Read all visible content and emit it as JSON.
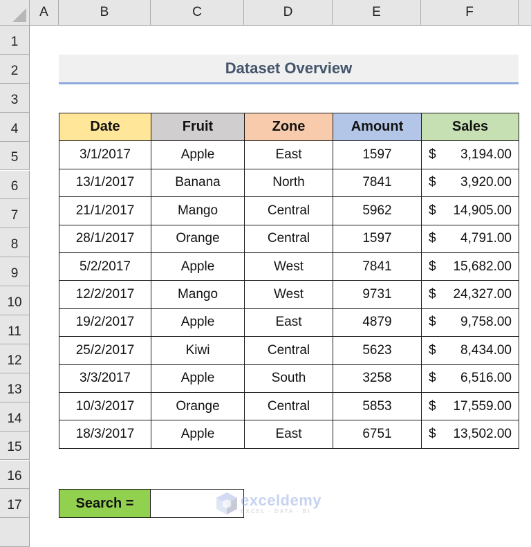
{
  "spreadsheet": {
    "column_headers": [
      "A",
      "B",
      "C",
      "D",
      "E",
      "F"
    ],
    "row_headers": [
      "1",
      "2",
      "3",
      "4",
      "5",
      "6",
      "7",
      "8",
      "9",
      "10",
      "11",
      "12",
      "13",
      "14",
      "15",
      "16",
      "17"
    ]
  },
  "title": "Dataset Overview",
  "table": {
    "headers": [
      {
        "label": "Date",
        "color": "#FFE699"
      },
      {
        "label": "Fruit",
        "color": "#D0CECE"
      },
      {
        "label": "Zone",
        "color": "#F8CBAD"
      },
      {
        "label": "Amount",
        "color": "#B4C6E7"
      },
      {
        "label": "Sales",
        "color": "#C6E0B4"
      }
    ],
    "currency_symbol": "$",
    "rows": [
      {
        "date": "3/1/2017",
        "fruit": "Apple",
        "zone": "East",
        "amount": "1597",
        "sales": "3,194.00"
      },
      {
        "date": "13/1/2017",
        "fruit": "Banana",
        "zone": "North",
        "amount": "7841",
        "sales": "3,920.00"
      },
      {
        "date": "21/1/2017",
        "fruit": "Mango",
        "zone": "Central",
        "amount": "5962",
        "sales": "14,905.00"
      },
      {
        "date": "28/1/2017",
        "fruit": "Orange",
        "zone": "Central",
        "amount": "1597",
        "sales": "4,791.00"
      },
      {
        "date": "5/2/2017",
        "fruit": "Apple",
        "zone": "West",
        "amount": "7841",
        "sales": "15,682.00"
      },
      {
        "date": "12/2/2017",
        "fruit": "Mango",
        "zone": "West",
        "amount": "9731",
        "sales": "24,327.00"
      },
      {
        "date": "19/2/2017",
        "fruit": "Apple",
        "zone": "East",
        "amount": "4879",
        "sales": "9,758.00"
      },
      {
        "date": "25/2/2017",
        "fruit": "Kiwi",
        "zone": "Central",
        "amount": "5623",
        "sales": "8,434.00"
      },
      {
        "date": "3/3/2017",
        "fruit": "Apple",
        "zone": "South",
        "amount": "3258",
        "sales": "6,516.00"
      },
      {
        "date": "10/3/2017",
        "fruit": "Orange",
        "zone": "Central",
        "amount": "5853",
        "sales": "17,559.00"
      },
      {
        "date": "18/3/2017",
        "fruit": "Apple",
        "zone": "East",
        "amount": "6751",
        "sales": "13,502.00"
      }
    ]
  },
  "search": {
    "label": "Search =",
    "label_color": "#92D050",
    "value": ""
  },
  "watermark": {
    "icon": "exceldemy-logo-icon",
    "name": "exceldemy",
    "tagline": "EXCEL · DATA · BI"
  }
}
